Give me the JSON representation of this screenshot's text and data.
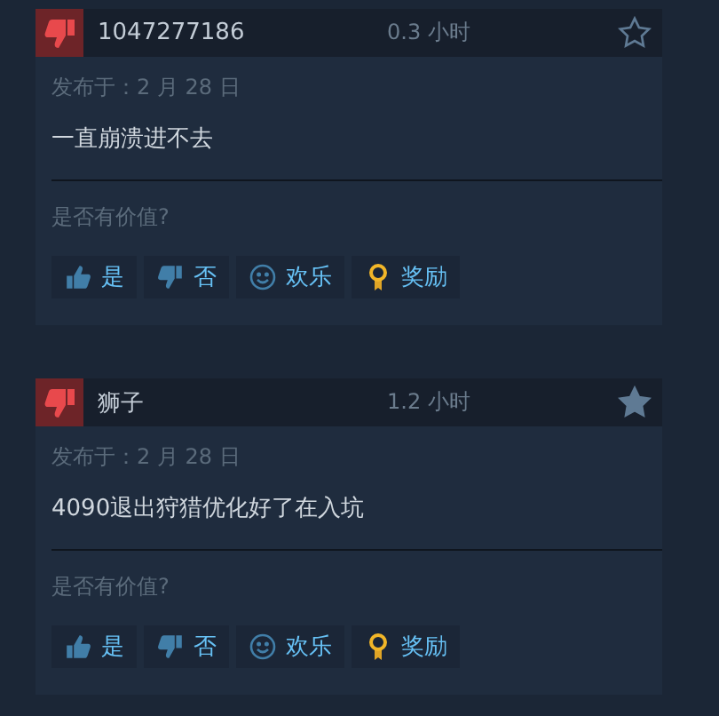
{
  "reviews": [
    {
      "recommended": false,
      "author": "1047277186",
      "hours": "0.3 小时",
      "favorited": false,
      "posted": "发布于：2 月 28 日",
      "text": "一直崩溃进不去",
      "helpful_prompt": "是否有价值?",
      "actions": [
        {
          "kind": "yes",
          "label": "是"
        },
        {
          "kind": "no",
          "label": "否"
        },
        {
          "kind": "funny",
          "label": "欢乐"
        },
        {
          "kind": "award",
          "label": "奖励"
        }
      ]
    },
    {
      "recommended": false,
      "author": "狮子",
      "hours": "1.2 小时",
      "favorited": true,
      "posted": "发布于：2 月 28 日",
      "text": "4090退出狩猎优化好了在入坑",
      "helpful_prompt": "是否有价值?",
      "actions": [
        {
          "kind": "yes",
          "label": "是"
        },
        {
          "kind": "no",
          "label": "否"
        },
        {
          "kind": "funny",
          "label": "欢乐"
        },
        {
          "kind": "award",
          "label": "奖励"
        }
      ]
    }
  ]
}
